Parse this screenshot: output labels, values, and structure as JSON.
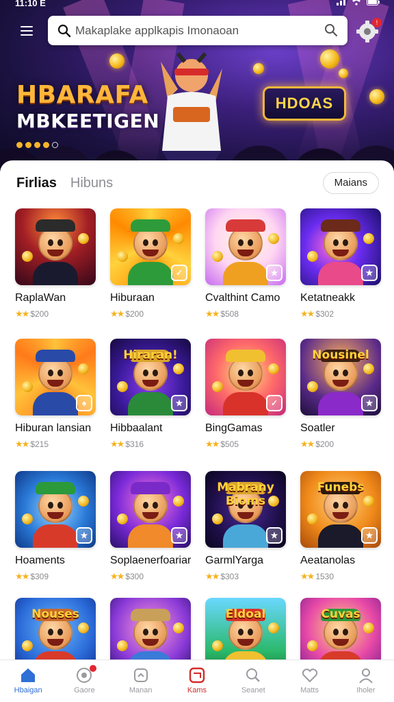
{
  "status_bar": {
    "time": "11:10 E"
  },
  "search": {
    "placeholder": "Makaplake applkapis Imonaoan",
    "value": ""
  },
  "hero": {
    "title_line1": "HBARAFA",
    "title_line2": "MBKEETIGEN",
    "sign_text": "HDOAS",
    "slide_count": 5,
    "active_slide": 0
  },
  "tabs": [
    {
      "label": "Firlias",
      "active": true
    },
    {
      "label": "Hibuns",
      "active": false
    }
  ],
  "more_button": "Maians",
  "games": [
    {
      "name": "RaplaWan",
      "rating": "$200",
      "theme": "concert",
      "title": "",
      "icon": "concert-icon"
    },
    {
      "name": "Hiburaan",
      "rating": "$200",
      "theme": "hat-kid",
      "title": "",
      "icon": "kid-green-cap-icon"
    },
    {
      "name": "Cvalthint Camo",
      "rating": "$508",
      "theme": "coins-party",
      "title": "",
      "icon": "party-coins-icon"
    },
    {
      "name": "Ketatneakk",
      "rating": "$302",
      "theme": "magic-girl",
      "title": "",
      "icon": "magic-girl-icon"
    },
    {
      "name": "Hiburan lansian",
      "rating": "$215",
      "theme": "captain-fox",
      "title": "",
      "icon": "fox-captain-icon"
    },
    {
      "name": "Hibbaalant",
      "rating": "$316",
      "theme": "hiraran",
      "title": "Hiraran!",
      "icon": "cocktail-kid-icon"
    },
    {
      "name": "BingGamas",
      "rating": "$505",
      "theme": "bingo",
      "title": "",
      "icon": "horn-kid-icon"
    },
    {
      "name": "Soatler",
      "rating": "$200",
      "theme": "friends",
      "title": "Nousinel",
      "icon": "friends-group-icon"
    },
    {
      "name": "Hoaments",
      "rating": "$309",
      "theme": "elves",
      "title": "",
      "icon": "elves-icon"
    },
    {
      "name": "Soplaenerfoariar",
      "rating": "$300",
      "theme": "cat",
      "title": "",
      "icon": "cat-mascot-icon"
    },
    {
      "name": "GarmlYarga",
      "rating": "$303",
      "theme": "bioms",
      "title": "Mabrany Bioms",
      "icon": "slot-bioms-icon"
    },
    {
      "name": "Aeatanolas",
      "rating": "1530",
      "theme": "businessman",
      "title": "Funebs",
      "icon": "businessman-icon"
    },
    {
      "name": "",
      "rating": "",
      "theme": "nouses",
      "title": "Nouses",
      "icon": "bearded-kid-icon"
    },
    {
      "name": "",
      "rating": "",
      "theme": "viking",
      "title": "",
      "icon": "viking-kid-icon"
    },
    {
      "name": "",
      "rating": "",
      "theme": "eldoal",
      "title": "Eldoal",
      "icon": "garden-icon"
    },
    {
      "name": "",
      "rating": "",
      "theme": "cuvas",
      "title": "Cuvas",
      "icon": "kids-group-icon"
    }
  ],
  "bottom_nav": [
    {
      "label": "Hbaigan",
      "icon": "home-icon",
      "state": "active"
    },
    {
      "label": "Gaore",
      "icon": "games-icon",
      "state": "dot"
    },
    {
      "label": "Manan",
      "icon": "store-icon",
      "state": ""
    },
    {
      "label": "Kams",
      "icon": "box-icon",
      "state": "red"
    },
    {
      "label": "Seanet",
      "icon": "search-icon",
      "state": ""
    },
    {
      "label": "Matts",
      "icon": "heart-icon",
      "state": ""
    },
    {
      "label": "Iholer",
      "icon": "profile-icon",
      "state": ""
    }
  ],
  "colors": {
    "accent": "#2f6fd6",
    "badge": "#e3262f",
    "star": "#f5b21d",
    "hero_title": "#ffb63a"
  }
}
